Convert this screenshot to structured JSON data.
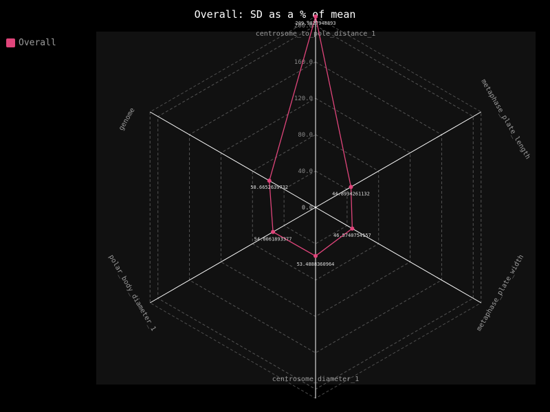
{
  "chart_data": {
    "type": "radar",
    "title": "Overall: SD as a % of mean",
    "axes": [
      "centrosome_to_pole_distance_1",
      "metaphase_plate_length",
      "metaphase_plate_width",
      "centrosome_diameter_1",
      "polar_body_diameter_1",
      "genome"
    ],
    "series": [
      {
        "name": "Overall",
        "values": [
          209.9827948893,
          44.8934261132,
          46.5740754157,
          53.4888360964,
          54.0061893377,
          58.6652639732
        ],
        "value_labels": [
          "209.9827948893",
          "44.8934261132",
          "46.5740754157",
          "53.4888360964",
          "54.0061893377",
          "58.6652639732"
        ]
      }
    ],
    "radial_ticks": [
      0,
      40,
      80,
      120,
      160,
      200
    ],
    "radial_tick_labels": [
      "0.0",
      "40.0",
      "80.0",
      "120.0",
      "160.0",
      "200.0"
    ],
    "rmax": 210,
    "grid": true,
    "legend_position": "top-left"
  },
  "colors": {
    "background": "#000000",
    "plot_background": "#111111",
    "series": "#e0457b",
    "grid": "#555555",
    "axis": "#ffffff"
  }
}
